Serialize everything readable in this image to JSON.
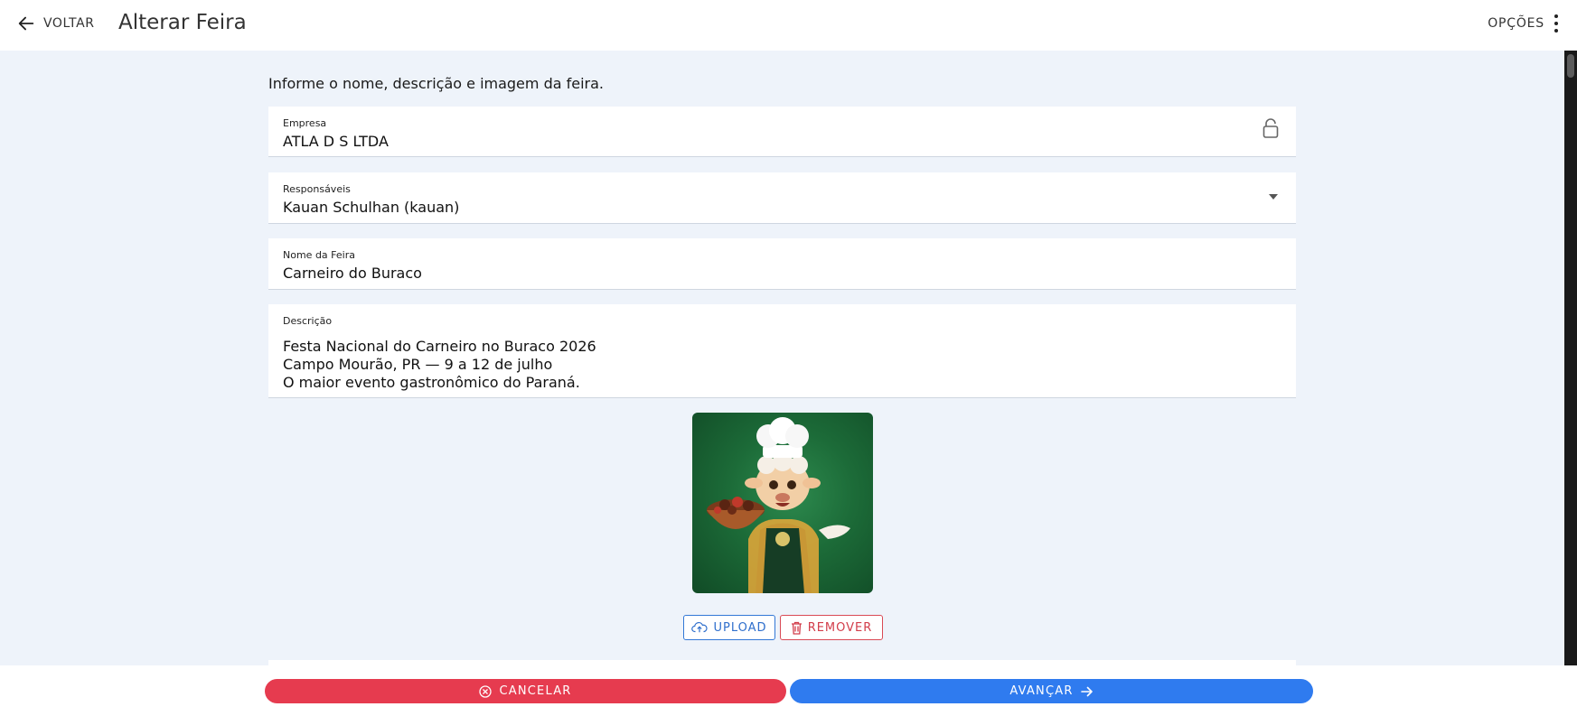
{
  "header": {
    "back_label": "VOLTAR",
    "title": "Alterar Feira",
    "options_label": "OPÇÕES"
  },
  "form": {
    "intro": "Informe o nome, descrição e imagem da feira.",
    "empresa": {
      "label": "Empresa",
      "value": "ATLA D S LTDA",
      "locked": true
    },
    "responsaveis": {
      "label": "Responsáveis",
      "value": "Kauan Schulhan (kauan)"
    },
    "nome": {
      "label": "Nome da Feira",
      "value": "Carneiro do Buraco"
    },
    "descricao": {
      "label": "Descrição",
      "value": "Festa Nacional do Carneiro no Buraco 2026\nCampo Mourão, PR — 9 a 12 de julho\nO maior evento gastronômico do Paraná."
    },
    "image": {
      "alt": "mascote carneiro chef"
    },
    "upload_label": "UPLOAD",
    "remove_label": "REMOVER"
  },
  "footer": {
    "cancel_label": "CANCELAR",
    "next_label": "AVANÇAR"
  },
  "colors": {
    "cancel": "#e63b4f",
    "next": "#2f7bef",
    "background": "#eef3fa"
  }
}
